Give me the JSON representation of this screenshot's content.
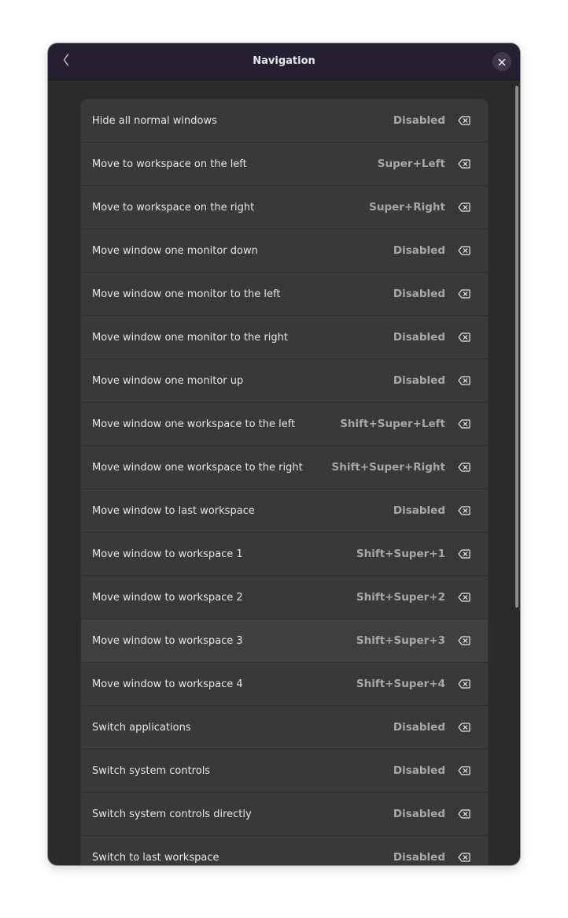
{
  "window": {
    "title": "Navigation"
  },
  "icons": {
    "back": "chevron-left-icon",
    "close": "close-icon",
    "clear": "backspace-clear-icon"
  },
  "colors": {
    "headerbar": "#241f31",
    "dialog_bg": "#2b2b2b",
    "row_bg": "#393939",
    "row_hover_bg": "#404040",
    "label_text": "#e6e6e6",
    "accel_text": "#a8a8a8"
  },
  "shortcuts": [
    {
      "label": "Hide all normal windows",
      "accel": "Disabled"
    },
    {
      "label": "Move to workspace on the left",
      "accel": "Super+Left"
    },
    {
      "label": "Move to workspace on the right",
      "accel": "Super+Right"
    },
    {
      "label": "Move window one monitor down",
      "accel": "Disabled"
    },
    {
      "label": "Move window one monitor to the left",
      "accel": "Disabled"
    },
    {
      "label": "Move window one monitor to the right",
      "accel": "Disabled"
    },
    {
      "label": "Move window one monitor up",
      "accel": "Disabled"
    },
    {
      "label": "Move window one workspace to the left",
      "accel": "Shift+Super+Left"
    },
    {
      "label": "Move window one workspace to the right",
      "accel": "Shift+Super+Right"
    },
    {
      "label": "Move window to last workspace",
      "accel": "Disabled"
    },
    {
      "label": "Move window to workspace 1",
      "accel": "Shift+Super+1"
    },
    {
      "label": "Move window to workspace 2",
      "accel": "Shift+Super+2"
    },
    {
      "label": "Move window to workspace 3",
      "accel": "Shift+Super+3",
      "hovered": true
    },
    {
      "label": "Move window to workspace 4",
      "accel": "Shift+Super+4"
    },
    {
      "label": "Switch applications",
      "accel": "Disabled"
    },
    {
      "label": "Switch system controls",
      "accel": "Disabled"
    },
    {
      "label": "Switch system controls directly",
      "accel": "Disabled"
    },
    {
      "label": "Switch to last workspace",
      "accel": "Disabled"
    }
  ]
}
